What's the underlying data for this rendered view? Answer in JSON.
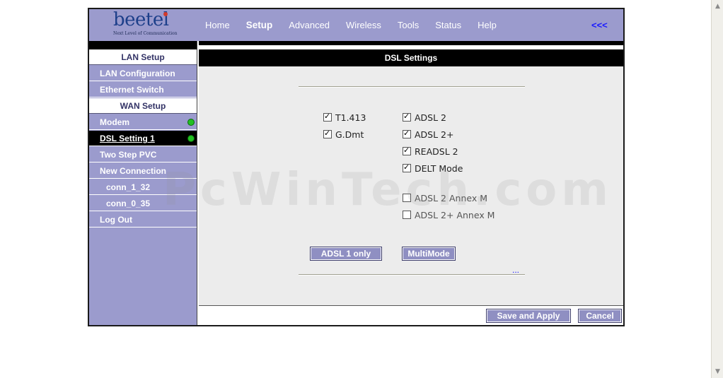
{
  "logo": {
    "word": "beetel",
    "tagline": "Next Level of Communication"
  },
  "nav": {
    "items": [
      "Home",
      "Setup",
      "Advanced",
      "Wireless",
      "Tools",
      "Status",
      "Help"
    ],
    "active": "Setup",
    "collapse_label": "<<<"
  },
  "sidebar": {
    "lan_header": "LAN Setup",
    "lan_configuration": "LAN Configuration",
    "ethernet_switch": "Ethernet Switch",
    "wan_header": "WAN Setup",
    "modem": "Modem",
    "dsl_setting": "DSL Setting 1",
    "two_step_pvc": "Two Step PVC",
    "new_connection": "New Connection",
    "conn_1_32": "conn_1_32",
    "conn_0_35": "conn_0_35",
    "log_out": "Log Out",
    "status_color": "#22c022"
  },
  "content": {
    "title": "DSL Settings",
    "options": {
      "t1413": {
        "label": "T1.413",
        "checked": true
      },
      "gdmt": {
        "label": "G.Dmt",
        "checked": true
      },
      "adsl2": {
        "label": "ADSL 2",
        "checked": true
      },
      "adsl2plus": {
        "label": "ADSL 2+",
        "checked": true
      },
      "readsl2": {
        "label": "READSL 2",
        "checked": true
      },
      "delt": {
        "label": "DELT Mode",
        "checked": true
      },
      "adsl2_annex_m": {
        "label": "ADSL 2 Annex M",
        "checked": false
      },
      "adsl2plus_annex_m": {
        "label": "ADSL 2+ Annex M",
        "checked": false
      }
    },
    "adsl1_only_button": "ADSL 1 only",
    "multimode_button": "MultiMode",
    "more_link": "...",
    "save_apply_button": "Save and Apply",
    "cancel_button": "Cancel"
  },
  "watermark": "PcWinTech.com",
  "colors": {
    "header_bg": "#9b9bcd",
    "button_bg": "#8f8fc2",
    "content_bg": "#ececec"
  }
}
